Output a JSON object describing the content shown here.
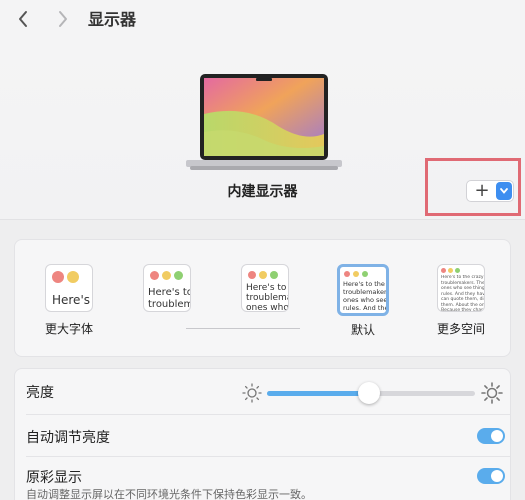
{
  "header": {
    "title": "显示器"
  },
  "display": {
    "name": "内建显示器",
    "add_symbol": "+"
  },
  "resolution_options": [
    {
      "label": "更大字体",
      "preview": "Here's"
    },
    {
      "label": "",
      "preview": "Here's to\ntroublem"
    },
    {
      "label": "",
      "preview": "Here's to t\ntroublema\nones who s"
    },
    {
      "label": "默认",
      "preview": "Here's to the c\ntroublemakers.\nones who see t\nrules. And the"
    },
    {
      "label": "更多空间",
      "preview": "Here's to the crazy one\ntroublemakers. The r\nones who see things\nrules. And they hav\ncan quote them, dis\nthem. About the onl\nBecause they chan"
    }
  ],
  "settings": {
    "brightness_label": "亮度",
    "brightness_level": 0.49,
    "auto_brightness_label": "自动调节亮度",
    "true_tone_label": "原彩显示",
    "true_tone_desc": "自动调整显示屏以在不同环境光条件下保持色彩显示一致。"
  },
  "colors": {
    "accent": "#5aacec",
    "highlight": "#e06a74",
    "button_blue": "#3d8ef0"
  }
}
